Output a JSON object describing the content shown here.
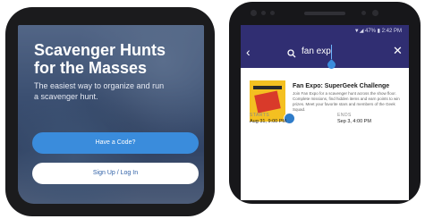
{
  "onboarding": {
    "title_line1": "Scavenger Hunts",
    "title_line2": "for the Masses",
    "subtitle": "The easiest way to organize and run a scavenger hunt.",
    "code_button": "Have a Code?",
    "signup_button": "Sign Up / Log In"
  },
  "search_screen": {
    "status": "▼◢ 47% ▮ 2:42 PM",
    "query": "fan exp",
    "result": {
      "title": "Fan Expo: SuperGeek Challenge",
      "description": "Join Fan Expo for a scavenger hunt across the show floor. Complete missions, find hidden items and earn points to win prizes. Meet your favorite stars and members of the Geek Squad.",
      "starts_label": "STARTS",
      "starts_value": "Aug 31, 9:00 PM",
      "ends_label": "ENDS",
      "ends_value": "Sep 3, 4:00 PM"
    }
  },
  "colors": {
    "header": "#302e72",
    "accent": "#3a8cdc"
  }
}
